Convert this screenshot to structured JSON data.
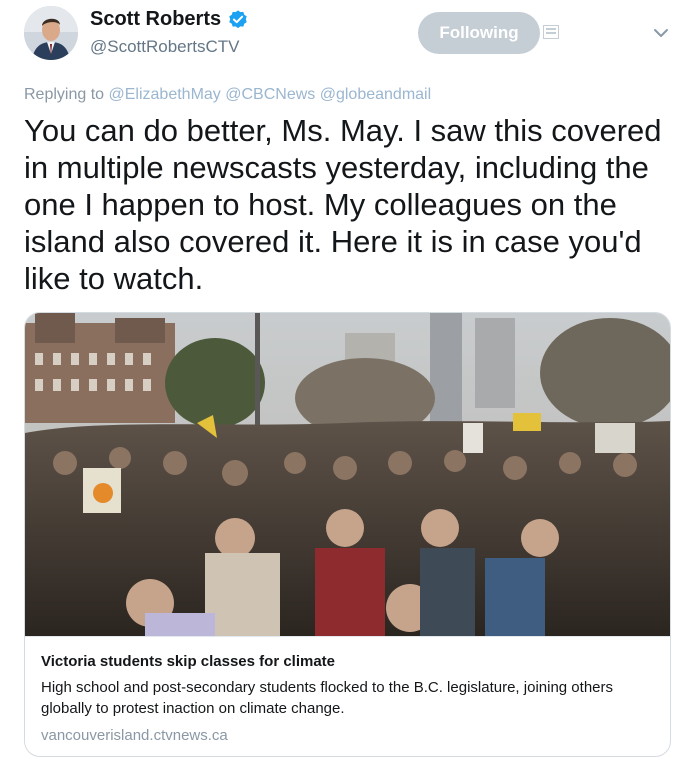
{
  "tweet": {
    "author": {
      "display_name": "Scott Roberts",
      "handle": "@ScottRobertsCTV",
      "verified": true
    },
    "follow_button_label": "Following",
    "replying_to_label": "Replying to",
    "replying_to_handles": [
      "@ElizabethMay",
      "@CBCNews",
      "@globeandmail"
    ],
    "text": "You can do better, Ms. May. I saw this covered in multiple newscasts yesterday, including the one I happen to host. My colleagues on the island also covered it. Here it is in case you'd like to watch."
  },
  "link_card": {
    "title": "Victoria students skip classes for climate",
    "description": "High school and post-secondary students flocked to the B.C. legislature, joining others globally to protest inaction on climate change.",
    "domain": "vancouverisland.ctvnews.ca",
    "image_subject": "crowd-at-legislature-photo"
  },
  "colors": {
    "verified_blue": "#1da1f2",
    "follow_button_bg": "#c5cdd5",
    "muted_text": "#8a98a5",
    "mention_text": "#9bb6d0"
  }
}
